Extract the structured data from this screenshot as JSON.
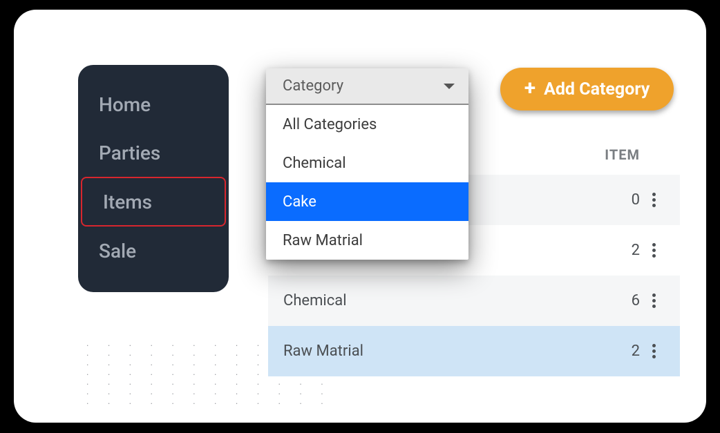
{
  "sidebar": {
    "items": [
      {
        "label": "Home"
      },
      {
        "label": "Parties"
      },
      {
        "label": "Items"
      },
      {
        "label": "Sale"
      }
    ],
    "highlight_index": 2
  },
  "dropdown": {
    "label": "Category",
    "options": [
      "All Categories",
      "Chemical",
      "Cake",
      "Raw Matrial"
    ],
    "selected_index": 2
  },
  "add_button": {
    "label": "Add Category"
  },
  "table": {
    "header": {
      "item": "ITEM"
    },
    "rows": [
      {
        "name": "",
        "count": 0
      },
      {
        "name": "",
        "count": 2
      },
      {
        "name": "Chemical",
        "count": 6
      },
      {
        "name": "Raw Matrial",
        "count": 2,
        "highlight": true
      }
    ]
  },
  "colors": {
    "sidebar_bg": "#212a37",
    "accent": "#efa22c",
    "primary": "#0a6cff",
    "highlight_border": "#d8262e"
  }
}
